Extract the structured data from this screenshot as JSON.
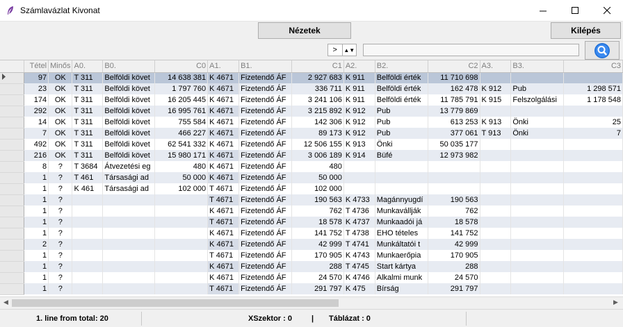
{
  "window": {
    "title": "Számlavázlat Kivonat"
  },
  "toolbar": {
    "views_label": "Nézetek",
    "exit_label": "Kilépés"
  },
  "nav": {
    "arrow": ">",
    "spin": "▲▼"
  },
  "search": {
    "placeholder": ""
  },
  "columns": [
    "Tétel",
    "Minős",
    "A0.",
    "B0.",
    "C0",
    "A1.",
    "B1.",
    "C1",
    "A2.",
    "B2.",
    "C2",
    "A3.",
    "B3.",
    "C3"
  ],
  "rows": [
    [
      "97",
      "OK",
      "T 311",
      "Belföldi követ",
      "14 638 381",
      "K 4671",
      "Fizetendő ÁF",
      "2 927 683",
      "K 911",
      "Belföldi érték",
      "11 710 698",
      "",
      "",
      ""
    ],
    [
      "23",
      "OK",
      "T 311",
      "Belföldi követ",
      "1 797 760",
      "K 4671",
      "Fizetendő ÁF",
      "336 711",
      "K 911",
      "Belföldi érték",
      "162 478",
      "K 912",
      "Pub",
      "1 298 571"
    ],
    [
      "174",
      "OK",
      "T 311",
      "Belföldi követ",
      "16 205 445",
      "K 4671",
      "Fizetendő ÁF",
      "3 241 106",
      "K 911",
      "Belföldi érték",
      "11 785 791",
      "K 915",
      "Felszolgálási",
      "1 178 548"
    ],
    [
      "292",
      "OK",
      "T 311",
      "Belföldi követ",
      "16 995 761",
      "K 4671",
      "Fizetendő ÁF",
      "3 215 892",
      "K 912",
      "Pub",
      "13 779 869",
      "",
      "",
      ""
    ],
    [
      "14",
      "OK",
      "T 311",
      "Belföldi követ",
      "755 584",
      "K 4671",
      "Fizetendő ÁF",
      "142 306",
      "K 912",
      "Pub",
      "613 253",
      "K 913",
      "Önki",
      "25"
    ],
    [
      "7",
      "OK",
      "T 311",
      "Belföldi követ",
      "466 227",
      "K 4671",
      "Fizetendő ÁF",
      "89 173",
      "K 912",
      "Pub",
      "377 061",
      "T 913",
      "Önki",
      "7"
    ],
    [
      "492",
      "OK",
      "T 311",
      "Belföldi követ",
      "62 541 332",
      "K 4671",
      "Fizetendő ÁF",
      "12 506 155",
      "K 913",
      "Önki",
      "50 035 177",
      "",
      "",
      ""
    ],
    [
      "216",
      "OK",
      "T 311",
      "Belföldi követ",
      "15 980 171",
      "K 4671",
      "Fizetendő ÁF",
      "3 006 189",
      "K 914",
      "Büfé",
      "12 973 982",
      "",
      "",
      ""
    ],
    [
      "8",
      "?",
      "T 3684",
      "Átvezetési eg",
      "480",
      "K 4671",
      "Fizetendő ÁF",
      "480",
      "",
      "",
      "",
      "",
      "",
      ""
    ],
    [
      "1",
      "?",
      "T 461",
      "Társasági ad",
      "50 000",
      "K 4671",
      "Fizetendő ÁF",
      "50 000",
      "",
      "",
      "",
      "",
      "",
      ""
    ],
    [
      "1",
      "?",
      "K 461",
      "Társasági ad",
      "102 000",
      "T 4671",
      "Fizetendő ÁF",
      "102 000",
      "",
      "",
      "",
      "",
      "",
      ""
    ],
    [
      "1",
      "?",
      "",
      "",
      "",
      "T 4671",
      "Fizetendő ÁF",
      "190 563",
      "K 4733",
      "Magánnyugdí",
      "190 563",
      "",
      "",
      ""
    ],
    [
      "1",
      "?",
      "",
      "",
      "",
      "K 4671",
      "Fizetendő ÁF",
      "762",
      "T 4736",
      "Munkavállják",
      "762",
      "",
      "",
      ""
    ],
    [
      "1",
      "?",
      "",
      "",
      "",
      "T 4671",
      "Fizetendő ÁF",
      "18 578",
      "K 4737",
      "Munkaadói já",
      "18 578",
      "",
      "",
      ""
    ],
    [
      "1",
      "?",
      "",
      "",
      "",
      "K 4671",
      "Fizetendő ÁF",
      "141 752",
      "T 4738",
      "EHO tételes",
      "141 752",
      "",
      "",
      ""
    ],
    [
      "2",
      "?",
      "",
      "",
      "",
      "K 4671",
      "Fizetendő ÁF",
      "42 999",
      "T 4741",
      "Munkáltatói t",
      "42 999",
      "",
      "",
      ""
    ],
    [
      "1",
      "?",
      "",
      "",
      "",
      "T 4671",
      "Fizetendő ÁF",
      "170 905",
      "K 4743",
      "Munkaerőpia",
      "170 905",
      "",
      "",
      ""
    ],
    [
      "1",
      "?",
      "",
      "",
      "",
      "K 4671",
      "Fizetendő ÁF",
      "288",
      "T 4745",
      "Start kártya",
      "288",
      "",
      "",
      ""
    ],
    [
      "1",
      "?",
      "",
      "",
      "",
      "K 4671",
      "Fizetendő ÁF",
      "24 570",
      "K 4746",
      "Alkalmi munk",
      "24 570",
      "",
      "",
      ""
    ],
    [
      "1",
      "?",
      "",
      "",
      "",
      "T 4671",
      "Fizetendő ÁF",
      "291 797",
      "K 475",
      "Bírság",
      "291 797",
      "",
      "",
      ""
    ]
  ],
  "status": {
    "line": "1. line from total: 20",
    "xszektor": "XSzektor : 0",
    "separator": "|",
    "tablazat": "Táblázat : 0"
  },
  "colors": {
    "selected_row": "#bac6d8",
    "alt_row": "#e7ebf2",
    "search_icon": "#1f6fd6"
  },
  "icons": {
    "app": "feather-icon",
    "search": "magnifier-icon"
  }
}
